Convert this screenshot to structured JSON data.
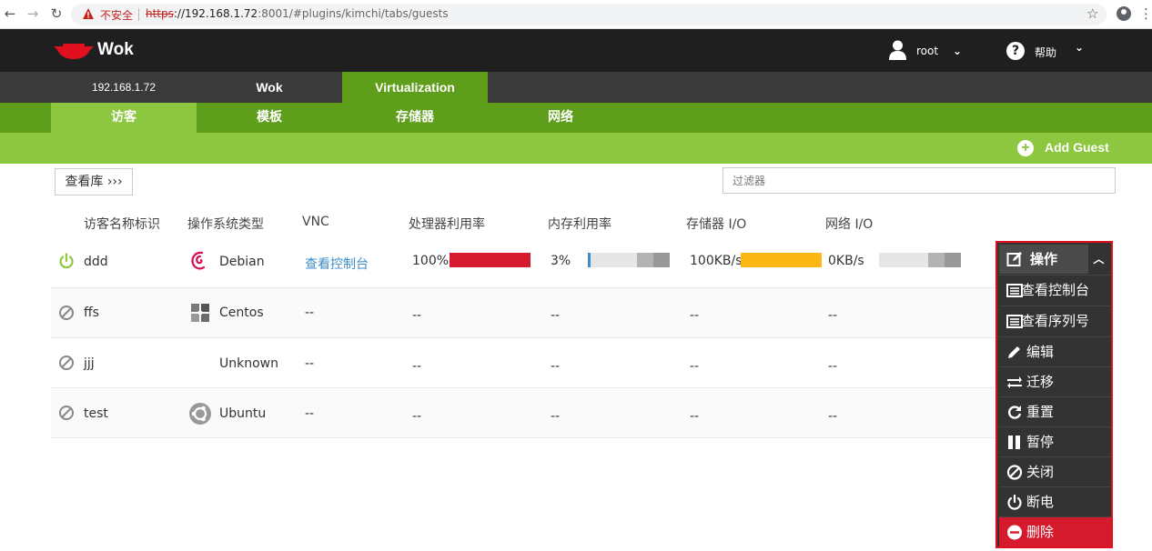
{
  "browser": {
    "insecure_label": "不安全",
    "url_scheme": "https",
    "url_host": "://192.168.1.72",
    "url_rest": ":8001/#plugins/kimchi/tabs/guests"
  },
  "header": {
    "brand": "Wok",
    "user": "root",
    "help": "帮助"
  },
  "host_tabs": [
    {
      "label": "192.168.1.72"
    },
    {
      "label": "Wok"
    },
    {
      "label": "Virtualization",
      "active": true
    }
  ],
  "sub_tabs": [
    {
      "label": "访客",
      "active": true
    },
    {
      "label": "模板"
    },
    {
      "label": "存储器"
    },
    {
      "label": "网络"
    }
  ],
  "toolbar": {
    "add_guest": "Add Guest",
    "gallery": "查看库 ›››",
    "filter_placeholder": "过滤器"
  },
  "columns": [
    "访客名称标识",
    "操作系统类型",
    "VNC",
    "处理器利用率",
    "内存利用率",
    "存储器 I/O",
    "网络 I/O"
  ],
  "guests": [
    {
      "name": "ddd",
      "state": "running",
      "os": "Debian",
      "vnc": "查看控制台",
      "cpu": "100%",
      "cpu_pct": 100,
      "mem": "3%",
      "mem_pct": 3,
      "storage": "100KB/s",
      "storage_pct": 100,
      "network": "0KB/s",
      "network_pct": 0
    },
    {
      "name": "ffs",
      "state": "stopped",
      "os": "Centos",
      "vnc": "--",
      "cpu": "--",
      "mem": "--",
      "storage": "--",
      "network": "--"
    },
    {
      "name": "jjj",
      "state": "stopped",
      "os": "Unknown",
      "vnc": "--",
      "cpu": "--",
      "mem": "--",
      "storage": "--",
      "network": "--"
    },
    {
      "name": "test",
      "state": "stopped",
      "os": "Ubuntu",
      "vnc": "--",
      "cpu": "--",
      "mem": "--",
      "storage": "--",
      "network": "--"
    }
  ],
  "actions_menu": {
    "title": "操作",
    "items": [
      {
        "label": "查看控制台",
        "icon": "console-icon"
      },
      {
        "label": "查看序列号",
        "icon": "serial-icon"
      },
      {
        "label": "编辑",
        "icon": "pencil-icon"
      },
      {
        "label": "迁移",
        "icon": "migrate-icon"
      },
      {
        "label": "重置",
        "icon": "refresh-icon"
      },
      {
        "label": "暂停",
        "icon": "pause-icon"
      },
      {
        "label": "关闭",
        "icon": "shutdown-icon"
      },
      {
        "label": "断电",
        "icon": "power-icon"
      },
      {
        "label": "删除",
        "icon": "delete-icon",
        "danger": true
      }
    ]
  },
  "colors": {
    "accent_green": "#8dc63f",
    "dark_green": "#5f9e1a",
    "cpu_bar": "#d51a2e",
    "storage_bar": "#fbb814",
    "mem_bar": "#3c8dc9",
    "running": "#8dc63f"
  }
}
